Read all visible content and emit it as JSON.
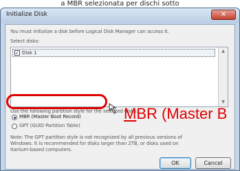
{
  "caption": "a MBR selezionata per dischi sotto",
  "dialog": {
    "title": "Initialize Disk",
    "close_glyph": "✕",
    "intro": "You must initialize a disk before Logical Disk Manager can access it.",
    "select_label": "Select disks:",
    "disks": [
      {
        "label": "Disk 1",
        "checked": true
      }
    ],
    "partition_prompt": "Use the following partition style for the selected disks:",
    "options": [
      {
        "label": "MBR (Master Boot Record)",
        "selected": true
      },
      {
        "label": "GPT (GUID Partition Table)",
        "selected": false
      }
    ],
    "note_lines": [
      "Note: The GPT partition style is not recognized by all previous versions of",
      "Windows. It is recommended for disks larger than 2TB, or disks used on",
      "Itanium-based computers."
    ],
    "ok_label": "OK",
    "cancel_label": "Cancel"
  },
  "annotation": {
    "first_letter": "M",
    "rest": "BR (Master B",
    "color": "#e00000"
  },
  "icons": {
    "check": "✓",
    "arrow": "arrow-pointer-icon"
  }
}
